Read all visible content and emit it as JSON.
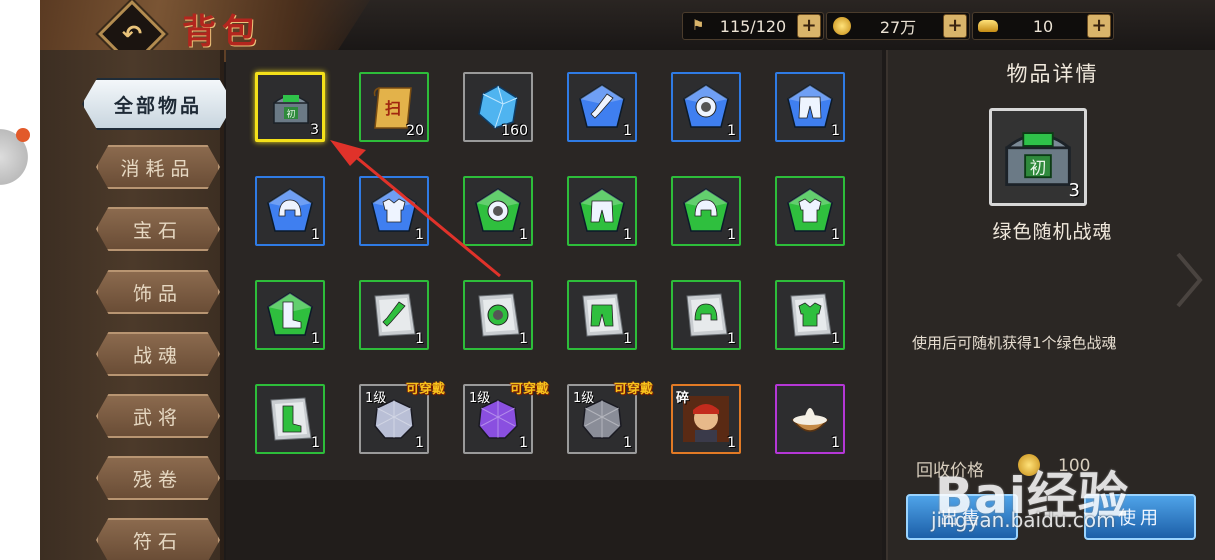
{
  "title": "背包",
  "resources": [
    {
      "icon": "banner-icon",
      "value": "115/120"
    },
    {
      "icon": "coin-icon",
      "value": "27万"
    },
    {
      "icon": "gold-ingot-icon",
      "value": "10"
    }
  ],
  "plus_label": "+",
  "categories": [
    {
      "label": "全部物品",
      "active": true
    },
    {
      "label": "消耗品"
    },
    {
      "label": "宝石"
    },
    {
      "label": "饰品"
    },
    {
      "label": "战魂"
    },
    {
      "label": "武将"
    },
    {
      "label": "残卷"
    },
    {
      "label": "符石"
    }
  ],
  "items": [
    {
      "rarity": "selected",
      "kind": "chest",
      "count": "3"
    },
    {
      "rarity": "green",
      "kind": "scroll",
      "count": "20"
    },
    {
      "rarity": "gray",
      "kind": "crystal",
      "count": "160"
    },
    {
      "rarity": "blue",
      "kind": "gem-weapon",
      "count": "1"
    },
    {
      "rarity": "blue",
      "kind": "gem-ring",
      "count": "1"
    },
    {
      "rarity": "blue",
      "kind": "gem-pants",
      "count": "1"
    },
    {
      "rarity": "blue",
      "kind": "gem-helmet",
      "count": "1"
    },
    {
      "rarity": "blue",
      "kind": "gem-armor",
      "count": "1"
    },
    {
      "rarity": "green",
      "kind": "gem-ring",
      "count": "1"
    },
    {
      "rarity": "green",
      "kind": "gem-pants",
      "count": "1"
    },
    {
      "rarity": "green",
      "kind": "gem-helmet",
      "count": "1"
    },
    {
      "rarity": "green",
      "kind": "gem-armor",
      "count": "1"
    },
    {
      "rarity": "green",
      "kind": "gem-boots",
      "count": "1"
    },
    {
      "rarity": "green",
      "kind": "page-weapon",
      "count": "1"
    },
    {
      "rarity": "green",
      "kind": "page-ring",
      "count": "1"
    },
    {
      "rarity": "green",
      "kind": "page-pants",
      "count": "1"
    },
    {
      "rarity": "green",
      "kind": "page-helmet",
      "count": "1"
    },
    {
      "rarity": "green",
      "kind": "page-armor",
      "count": "1"
    },
    {
      "rarity": "green",
      "kind": "page-boots",
      "count": "1"
    },
    {
      "rarity": "gray",
      "kind": "soul-gray",
      "count": "1",
      "level": "1级",
      "badge": "可穿戴"
    },
    {
      "rarity": "gray",
      "kind": "soul-purple",
      "count": "1",
      "level": "1级",
      "badge": "可穿戴"
    },
    {
      "rarity": "gray",
      "kind": "soul-dark",
      "count": "1",
      "level": "1级",
      "badge": "可穿戴"
    },
    {
      "rarity": "orange",
      "kind": "hero-portrait",
      "count": "1",
      "fragment": "碎"
    },
    {
      "rarity": "purple",
      "kind": "bowl",
      "count": "1"
    }
  ],
  "detail": {
    "heading": "物品详情",
    "count": "3",
    "name": "绿色随机战魂",
    "description": "使用后可随机获得1个绿色战魂",
    "price_label": "回收价格",
    "price_value": "100",
    "sell_label": "出售",
    "use_label": "使用"
  },
  "watermark": {
    "logo": "Bai经验",
    "url": "jingyan.baidu.com"
  },
  "colors": {
    "selected": "#f4e01a",
    "blue": "#2f7be5",
    "green": "#2dbd3a",
    "gray": "#9a9a9a",
    "orange": "#e27a25",
    "purple": "#b537d6",
    "annotation_arrow": "#e0322a"
  }
}
